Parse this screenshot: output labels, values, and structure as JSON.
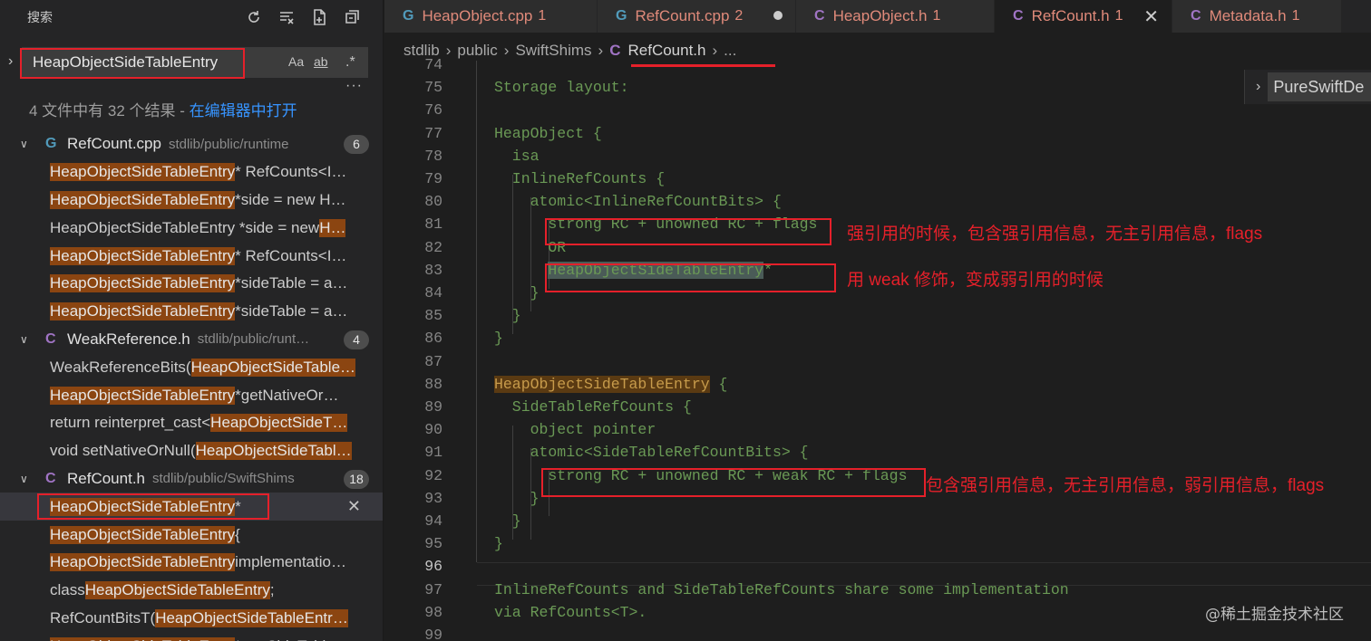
{
  "sidebar": {
    "title": "搜索",
    "search_value": "HeapObjectSideTableEntry",
    "options": {
      "match_case": "Aa",
      "whole_word": "ab",
      "regex": ".*"
    },
    "summary_prefix": "4 文件中有 32 个结果 - ",
    "summary_link": "在编辑器中打开",
    "groups": [
      {
        "name": "RefCount.cpp",
        "path": "stdlib/public/runtime",
        "count": "6",
        "icon": "cpp-file-icon",
        "matches": [
          {
            "pre": "",
            "hit": "HeapObjectSideTableEntry",
            "post": "* RefCounts<I…"
          },
          {
            "pre": "",
            "hit": "HeapObjectSideTableEntry",
            "post": " *side = new H…"
          },
          {
            "pre": "HeapObjectSideTableEntry *side = new ",
            "hit": "H…",
            "post": ""
          },
          {
            "pre": "",
            "hit": "HeapObjectSideTableEntry",
            "post": "* RefCounts<I…"
          },
          {
            "pre": "",
            "hit": "HeapObjectSideTableEntry",
            "post": " *sideTable = a…"
          },
          {
            "pre": "",
            "hit": "HeapObjectSideTableEntry",
            "post": " *sideTable = a…"
          }
        ]
      },
      {
        "name": "WeakReference.h",
        "path": "stdlib/public/runt…",
        "count": "4",
        "icon": "c-header-icon",
        "matches": [
          {
            "pre": "WeakReferenceBits(",
            "hit": "HeapObjectSideTable…",
            "post": ""
          },
          {
            "pre": "",
            "hit": "HeapObjectSideTableEntry",
            "post": " *getNativeOr…"
          },
          {
            "pre": "return reinterpret_cast<",
            "hit": "HeapObjectSideT…",
            "post": ""
          },
          {
            "pre": "void setNativeOrNull(",
            "hit": "HeapObjectSideTabl…",
            "post": ""
          }
        ]
      },
      {
        "name": "RefCount.h",
        "path": "stdlib/public/SwiftShims",
        "count": "18",
        "icon": "c-header-icon",
        "matches": [
          {
            "pre": "",
            "hit": "HeapObjectSideTableEntry",
            "post": "*"
          },
          {
            "pre": "",
            "hit": "HeapObjectSideTableEntry",
            "post": " {"
          },
          {
            "pre": "",
            "hit": "HeapObjectSideTableEntry",
            "post": " implementatio…"
          },
          {
            "pre": "class ",
            "hit": "HeapObjectSideTableEntry",
            "post": ";"
          },
          {
            "pre": "RefCountBitsT(",
            "hit": "HeapObjectSideTableEntr…",
            "post": ""
          },
          {
            "pre": "",
            "hit": "HeapObjectSideTableEntry",
            "post": "* getSideTabl…"
          }
        ]
      }
    ]
  },
  "tabs": [
    {
      "icon": "G",
      "label": "HeapObject.cpp",
      "badge": "1",
      "kind": "cpp"
    },
    {
      "icon": "G",
      "label": "RefCount.cpp",
      "badge": "2",
      "kind": "cpp",
      "dirty": true
    },
    {
      "icon": "C",
      "label": "HeapObject.h",
      "badge": "1",
      "kind": "h"
    },
    {
      "icon": "C",
      "label": "RefCount.h",
      "badge": "1",
      "kind": "h",
      "active": true
    },
    {
      "icon": "C",
      "label": "Metadata.h",
      "badge": "1",
      "kind": "h"
    }
  ],
  "breadcrumb": [
    "stdlib",
    "public",
    "SwiftShims",
    "RefCount.h",
    "..."
  ],
  "sticky_scroll": "PureSwiftDe",
  "code_lines": [
    {
      "n": "74",
      "text": ""
    },
    {
      "n": "75",
      "text": "Storage layout:"
    },
    {
      "n": "76",
      "text": ""
    },
    {
      "n": "77",
      "text": "HeapObject {"
    },
    {
      "n": "78",
      "text": "  isa"
    },
    {
      "n": "79",
      "text": "  InlineRefCounts {"
    },
    {
      "n": "80",
      "text": "    atomic<InlineRefCountBits> {"
    },
    {
      "n": "81",
      "text": "      strong RC + unowned RC + flags"
    },
    {
      "n": "82",
      "text": "      OR"
    },
    {
      "n": "83",
      "text": "      HeapObjectSideTableEntry*"
    },
    {
      "n": "84",
      "text": "    }"
    },
    {
      "n": "85",
      "text": "  }"
    },
    {
      "n": "86",
      "text": "}"
    },
    {
      "n": "87",
      "text": ""
    },
    {
      "n": "88",
      "text": "HeapObjectSideTableEntry {"
    },
    {
      "n": "89",
      "text": "  SideTableRefCounts {"
    },
    {
      "n": "90",
      "text": "    object pointer"
    },
    {
      "n": "91",
      "text": "    atomic<SideTableRefCountBits> {"
    },
    {
      "n": "92",
      "text": "      strong RC + unowned RC + weak RC + flags"
    },
    {
      "n": "93",
      "text": "    }"
    },
    {
      "n": "94",
      "text": "  }"
    },
    {
      "n": "95",
      "text": "}"
    },
    {
      "n": "96",
      "text": ""
    },
    {
      "n": "97",
      "text": "InlineRefCounts and SideTableRefCounts share some implementation"
    },
    {
      "n": "98",
      "text": "via RefCounts<T>."
    },
    {
      "n": "99",
      "text": ""
    }
  ],
  "annotations": {
    "line81": "强引用的时候，包含强引用信息，无主引用信息，flags",
    "line83": "用 weak 修饰，变成弱引用的时候",
    "line92": "包含强引用信息，无主引用信息，弱引用信息，flags"
  },
  "watermark": "@稀土掘金技术社区",
  "colors": {
    "accent_red": "#e5202a",
    "match_highlight": "#8b4511",
    "comment_green": "#6a9955",
    "link_blue": "#3794ff"
  }
}
